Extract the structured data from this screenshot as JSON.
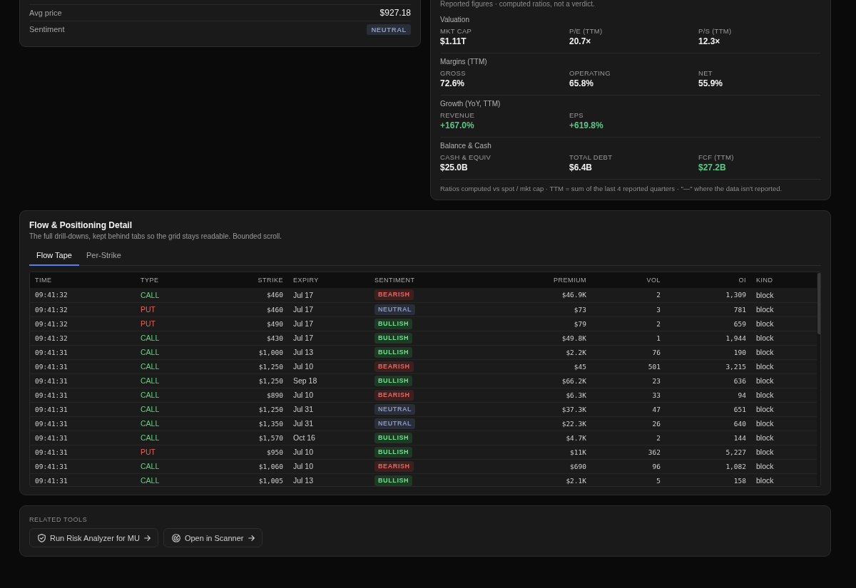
{
  "summary": {
    "rows": [
      {
        "kind": "text",
        "label": "Avg price",
        "value": "$927.18"
      },
      {
        "kind": "badge",
        "label": "Sentiment",
        "value": "NEUTRAL",
        "color": "#2a2e38"
      }
    ]
  },
  "fundamentals": {
    "note": "Reported figures · computed ratios, not a verdict.",
    "sections": [
      {
        "title": "Valuation",
        "metrics": [
          {
            "label": "MKT CAP",
            "value": "$1.11T",
            "color": "#f2f2f2"
          },
          {
            "label": "P/E (TTM)",
            "value": "20.7×",
            "color": "#f2f2f2"
          },
          {
            "label": "P/S (TTM)",
            "value": "12.3×",
            "color": "#f2f2f2"
          }
        ]
      },
      {
        "title": "Margins (TTM)",
        "metrics": [
          {
            "label": "GROSS",
            "value": "72.6%",
            "color": "#f2f2f2"
          },
          {
            "label": "OPERATING",
            "value": "65.8%",
            "color": "#f2f2f2"
          },
          {
            "label": "NET",
            "value": "55.9%",
            "color": "#f2f2f2"
          }
        ]
      },
      {
        "title": "Growth (YoY, TTM)",
        "metrics": [
          {
            "label": "REVENUE",
            "value": "+167.0%",
            "color": "#5cc58a"
          },
          {
            "label": "EPS",
            "value": "+619.8%",
            "color": "#5cc58a"
          }
        ]
      },
      {
        "title": "Balance & Cash",
        "metrics": [
          {
            "label": "CASH & EQUIV",
            "value": "$25.0B",
            "color": "#f2f2f2"
          },
          {
            "label": "TOTAL DEBT",
            "value": "$6.4B",
            "color": "#f2f2f2"
          },
          {
            "label": "FCF (TTM)",
            "value": "$27.2B",
            "color": "#5cc58a"
          }
        ]
      }
    ],
    "footnote": "Ratios computed vs spot / mkt cap · TTM = sum of the last 4 reported quarters · \"—\" where the data isn't reported."
  },
  "flow_detail": {
    "title": "Flow & Positioning Detail",
    "subtitle": "The full drill-downs, kept behind tabs so the grid stays readable. Bounded scroll.",
    "tabs": [
      {
        "label": "Flow Tape",
        "selected": true
      },
      {
        "label": "Per-Strike",
        "selected": false
      }
    ],
    "table": {
      "columns": [
        {
          "label": "TIME",
          "kind": "mono"
        },
        {
          "label": "TYPE",
          "kind": "colored"
        },
        {
          "label": "STRIKE",
          "kind": "figure"
        },
        {
          "label": "EXPIRY",
          "kind": "text"
        },
        {
          "label": "SENTIMENT",
          "kind": "badge"
        },
        {
          "label": "PREMIUM",
          "kind": "figure"
        },
        {
          "label": "VOL",
          "kind": "figure"
        },
        {
          "label": "OI",
          "kind": "figure"
        },
        {
          "label": "KIND",
          "kind": "text"
        }
      ],
      "rows": [
        [
          "09:41:32",
          {
            "text": "CALL",
            "color": "#5fcf80"
          },
          "$460",
          "Jul 17",
          {
            "text": "BEARISH",
            "color": "#3d1f1e"
          },
          "$46.9K",
          "2",
          "1,309",
          "block"
        ],
        [
          "09:41:32",
          {
            "text": "PUT",
            "color": "#e0645c"
          },
          "$460",
          "Jul 17",
          {
            "text": "NEUTRAL",
            "color": "#2a2e38"
          },
          "$73",
          "3",
          "781",
          "block"
        ],
        [
          "09:41:32",
          {
            "text": "PUT",
            "color": "#e0645c"
          },
          "$490",
          "Jul 17",
          {
            "text": "BULLISH",
            "color": "#1d3a25"
          },
          "$79",
          "2",
          "659",
          "block"
        ],
        [
          "09:41:32",
          {
            "text": "CALL",
            "color": "#5fcf80"
          },
          "$430",
          "Jul 17",
          {
            "text": "BULLISH",
            "color": "#1d3a25"
          },
          "$49.8K",
          "1",
          "1,944",
          "block"
        ],
        [
          "09:41:31",
          {
            "text": "CALL",
            "color": "#5fcf80"
          },
          "$1,000",
          "Jul 13",
          {
            "text": "BULLISH",
            "color": "#1d3a25"
          },
          "$2.2K",
          "76",
          "190",
          "block"
        ],
        [
          "09:41:31",
          {
            "text": "CALL",
            "color": "#5fcf80"
          },
          "$1,250",
          "Jul 10",
          {
            "text": "BEARISH",
            "color": "#3d1f1e"
          },
          "$45",
          "501",
          "3,215",
          "block"
        ],
        [
          "09:41:31",
          {
            "text": "CALL",
            "color": "#5fcf80"
          },
          "$1,250",
          "Sep 18",
          {
            "text": "BULLISH",
            "color": "#1d3a25"
          },
          "$66.2K",
          "23",
          "636",
          "block"
        ],
        [
          "09:41:31",
          {
            "text": "CALL",
            "color": "#5fcf80"
          },
          "$890",
          "Jul 10",
          {
            "text": "BEARISH",
            "color": "#3d1f1e"
          },
          "$6.3K",
          "33",
          "94",
          "block"
        ],
        [
          "09:41:31",
          {
            "text": "CALL",
            "color": "#5fcf80"
          },
          "$1,250",
          "Jul 31",
          {
            "text": "NEUTRAL",
            "color": "#2a2e38"
          },
          "$37.3K",
          "47",
          "651",
          "block"
        ],
        [
          "09:41:31",
          {
            "text": "CALL",
            "color": "#5fcf80"
          },
          "$1,350",
          "Jul 31",
          {
            "text": "NEUTRAL",
            "color": "#2a2e38"
          },
          "$22.3K",
          "26",
          "640",
          "block"
        ],
        [
          "09:41:31",
          {
            "text": "CALL",
            "color": "#5fcf80"
          },
          "$1,570",
          "Oct 16",
          {
            "text": "BULLISH",
            "color": "#1d3a25"
          },
          "$4.7K",
          "2",
          "144",
          "block"
        ],
        [
          "09:41:31",
          {
            "text": "PUT",
            "color": "#e0645c"
          },
          "$950",
          "Jul 10",
          {
            "text": "BULLISH",
            "color": "#1d3a25"
          },
          "$11K",
          "362",
          "5,227",
          "block"
        ],
        [
          "09:41:31",
          {
            "text": "CALL",
            "color": "#5fcf80"
          },
          "$1,060",
          "Jul 10",
          {
            "text": "BEARISH",
            "color": "#3d1f1e"
          },
          "$690",
          "96",
          "1,082",
          "block"
        ],
        [
          "09:41:31",
          {
            "text": "CALL",
            "color": "#5fcf80"
          },
          "$1,005",
          "Jul 13",
          {
            "text": "BULLISH",
            "color": "#1d3a25"
          },
          "$2.1K",
          "5",
          "158",
          "block"
        ]
      ]
    }
  },
  "related_tools": {
    "title": "RELATED TOOLS",
    "links": [
      {
        "label": "Run Risk Analyzer for MU",
        "kind": "shield"
      },
      {
        "label": "Open in Scanner",
        "kind": "scanner"
      }
    ]
  }
}
